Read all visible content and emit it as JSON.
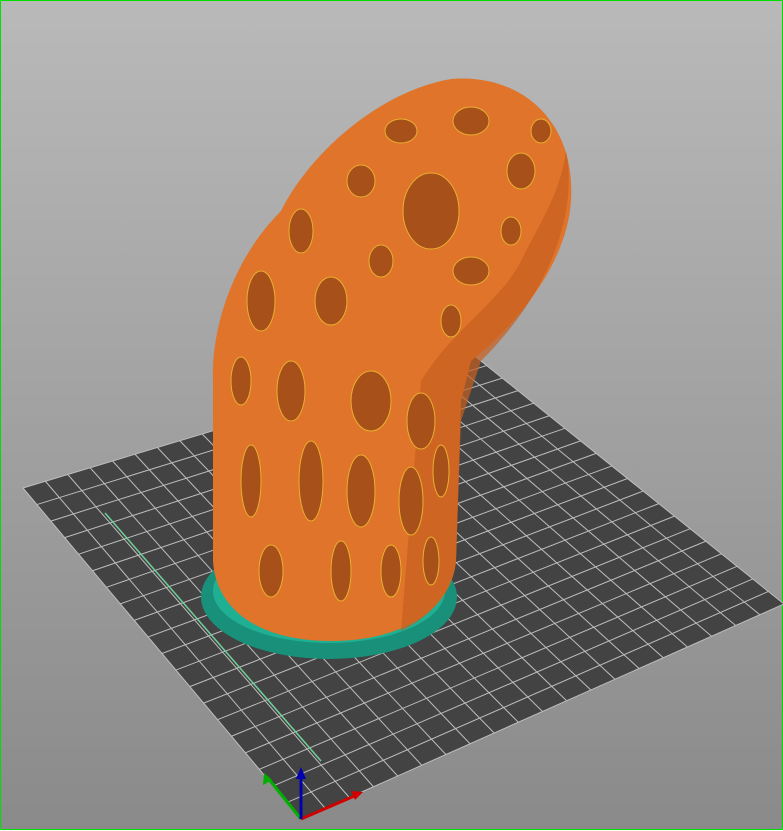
{
  "viewport": {
    "mode": "3d-preview",
    "colors": {
      "bed": "#434343",
      "grid": "#c8c8c8",
      "model": "#e0742a",
      "model_shadow": "#a8501a",
      "highlight": "#e8c030",
      "skirt": "#1aa087",
      "axis_x": "#e00000",
      "axis_y": "#00c000",
      "axis_z": "#0000c0",
      "y_line": "#6fd09a"
    },
    "grid_divisions": 20
  }
}
